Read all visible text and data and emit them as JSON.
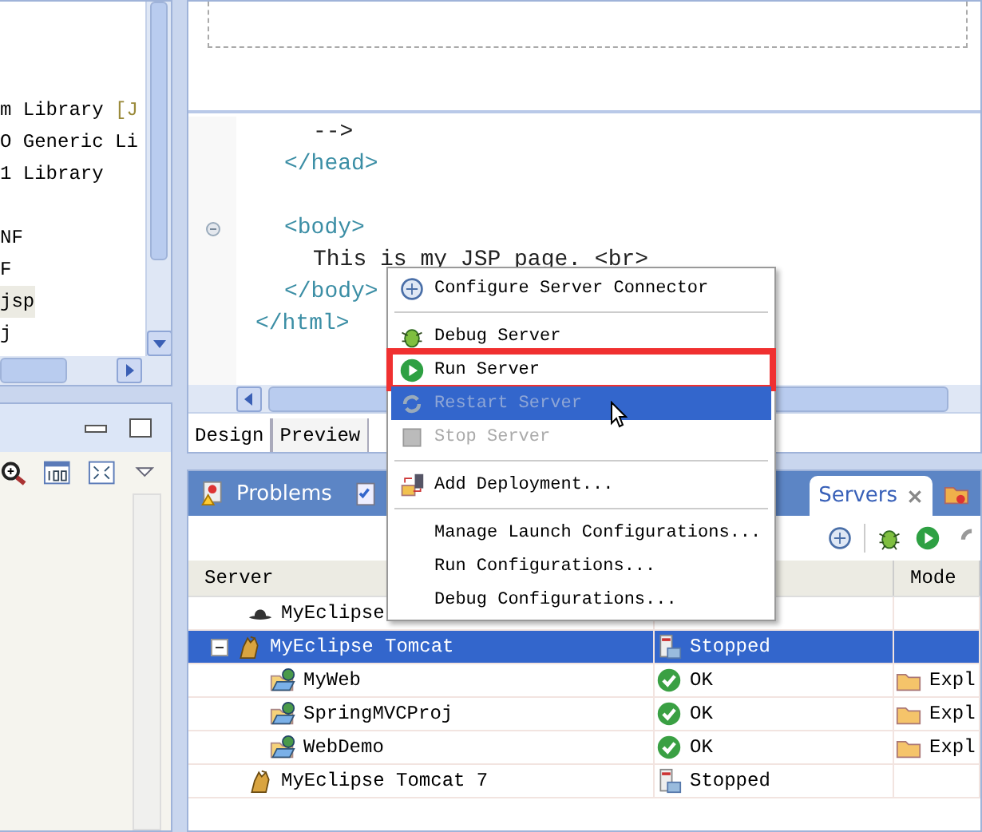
{
  "explorer": {
    "items": [
      {
        "text": "m Library",
        "decoration": "[J",
        "selected": false
      },
      {
        "text": "O Generic Li",
        "selected": false
      },
      {
        "text": "1 Library",
        "selected": false
      },
      {
        "selected": false
      },
      {
        "text": "NF",
        "selected": false
      },
      {
        "text": "F",
        "selected": false
      },
      {
        "text": "jsp",
        "selected": true
      },
      {
        "text": "j",
        "selected": false
      }
    ]
  },
  "editor": {
    "code_lines": [
      {
        "kind": "group",
        "children": [
          {
            "kind": "group",
            "children": [
              {
                "kind": "code",
                "text": "-->",
                "fold": false
              }
            ]
          },
          {
            "kind": "code",
            "text": "</head>",
            "fold": false
          },
          {
            "kind": "blank"
          },
          {
            "kind": "code",
            "text": "<body>",
            "fold": true,
            "children": [
              {
                "kind": "code",
                "text": "This is my JSP page. <br>",
                "fold": false
              }
            ]
          },
          {
            "kind": "code",
            "text": "</body>",
            "fold": false
          }
        ]
      },
      {
        "kind": "code",
        "text": "</html>",
        "fold": false
      }
    ],
    "tabs": [
      {
        "label": "Design",
        "selected": false
      },
      {
        "label": "Preview",
        "selected": true
      }
    ]
  },
  "context_menu": {
    "items": [
      {
        "kind": "item",
        "label": "Configure Server Connector",
        "disabled": false,
        "selected": false,
        "annotated": false
      },
      {
        "kind": "separator"
      },
      {
        "kind": "item",
        "label": "Debug Server",
        "disabled": false,
        "selected": false,
        "annotated": false
      },
      {
        "kind": "item",
        "label": "Run Server",
        "disabled": false,
        "selected": false,
        "annotated": true
      },
      {
        "kind": "item",
        "label": "Restart Server",
        "disabled": true,
        "selected": true,
        "annotated": false
      },
      {
        "kind": "item",
        "label": "Stop Server",
        "disabled": true,
        "selected": false,
        "annotated": false
      },
      {
        "kind": "separator"
      },
      {
        "kind": "item",
        "label": "Add Deployment...",
        "disabled": false,
        "selected": false,
        "annotated": false
      },
      {
        "kind": "separator"
      },
      {
        "kind": "item",
        "label": "Manage Launch Configurations...",
        "disabled": false,
        "selected": false,
        "annotated": false
      },
      {
        "kind": "item",
        "label": "Run Configurations...",
        "disabled": false,
        "selected": false,
        "annotated": false
      },
      {
        "kind": "item",
        "label": "Debug Configurations...",
        "disabled": false,
        "selected": false,
        "annotated": false
      }
    ]
  },
  "bottom_panel": {
    "tabs": [
      {
        "label": "Problems",
        "selected": false
      },
      {
        "selected": false
      },
      {
        "label": "Servers",
        "selected": true
      },
      {
        "selected": false
      }
    ],
    "table": {
      "columns": [
        "Server",
        "Mode"
      ],
      "rows": [
        {
          "kind": "server",
          "server": "MyEclipse",
          "selected": false
        },
        {
          "kind": "server",
          "server": "MyEclipse Tomcat",
          "state": "Stopped",
          "selected": true,
          "expanded": true,
          "children": [
            {
              "kind": "module",
              "server": "MyWeb",
              "state": "OK",
              "mode": "Expl",
              "selected": false
            },
            {
              "kind": "module",
              "server": "SpringMVCProj",
              "state": "OK",
              "mode": "Expl",
              "selected": false
            },
            {
              "kind": "module",
              "server": "WebDemo",
              "state": "OK",
              "mode": "Expl",
              "selected": false
            }
          ]
        },
        {
          "kind": "server",
          "server": "MyEclipse Tomcat 7",
          "state": "Stopped",
          "selected": false
        }
      ]
    }
  }
}
